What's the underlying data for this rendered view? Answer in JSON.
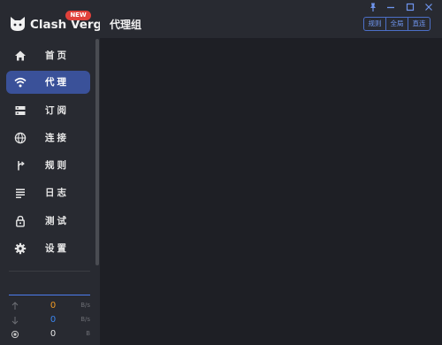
{
  "app": {
    "name": "Clash Verge",
    "badge": "NEW"
  },
  "header": {
    "title": "代理组",
    "modes": [
      "规则",
      "全局",
      "直连"
    ]
  },
  "window_controls": [
    "pin-icon",
    "minimize-icon",
    "maximize-icon",
    "close-icon"
  ],
  "nav": {
    "items": [
      {
        "label": "首页",
        "icon": "home-icon",
        "active": false
      },
      {
        "label": "代理",
        "icon": "wifi-icon",
        "active": true
      },
      {
        "label": "订阅",
        "icon": "dns-icon",
        "active": false
      },
      {
        "label": "连接",
        "icon": "globe-icon",
        "active": false
      },
      {
        "label": "规则",
        "icon": "route-icon",
        "active": false
      },
      {
        "label": "日志",
        "icon": "list-icon",
        "active": false
      },
      {
        "label": "测试",
        "icon": "lock-icon",
        "active": false
      },
      {
        "label": "设置",
        "icon": "gear-icon",
        "active": false
      }
    ]
  },
  "traffic": {
    "upload": {
      "value": "0",
      "unit": "B/s",
      "color": "#f29b24"
    },
    "download": {
      "value": "0",
      "unit": "B/s",
      "color": "#3c86f0"
    },
    "memory": {
      "value": "0",
      "unit": "B",
      "color": "#e6e6e6"
    }
  },
  "colors": {
    "accent": "#3a5199",
    "sidebar_bg": "#282a31",
    "main_bg": "#1e1f25",
    "badge": "#e0413b"
  }
}
